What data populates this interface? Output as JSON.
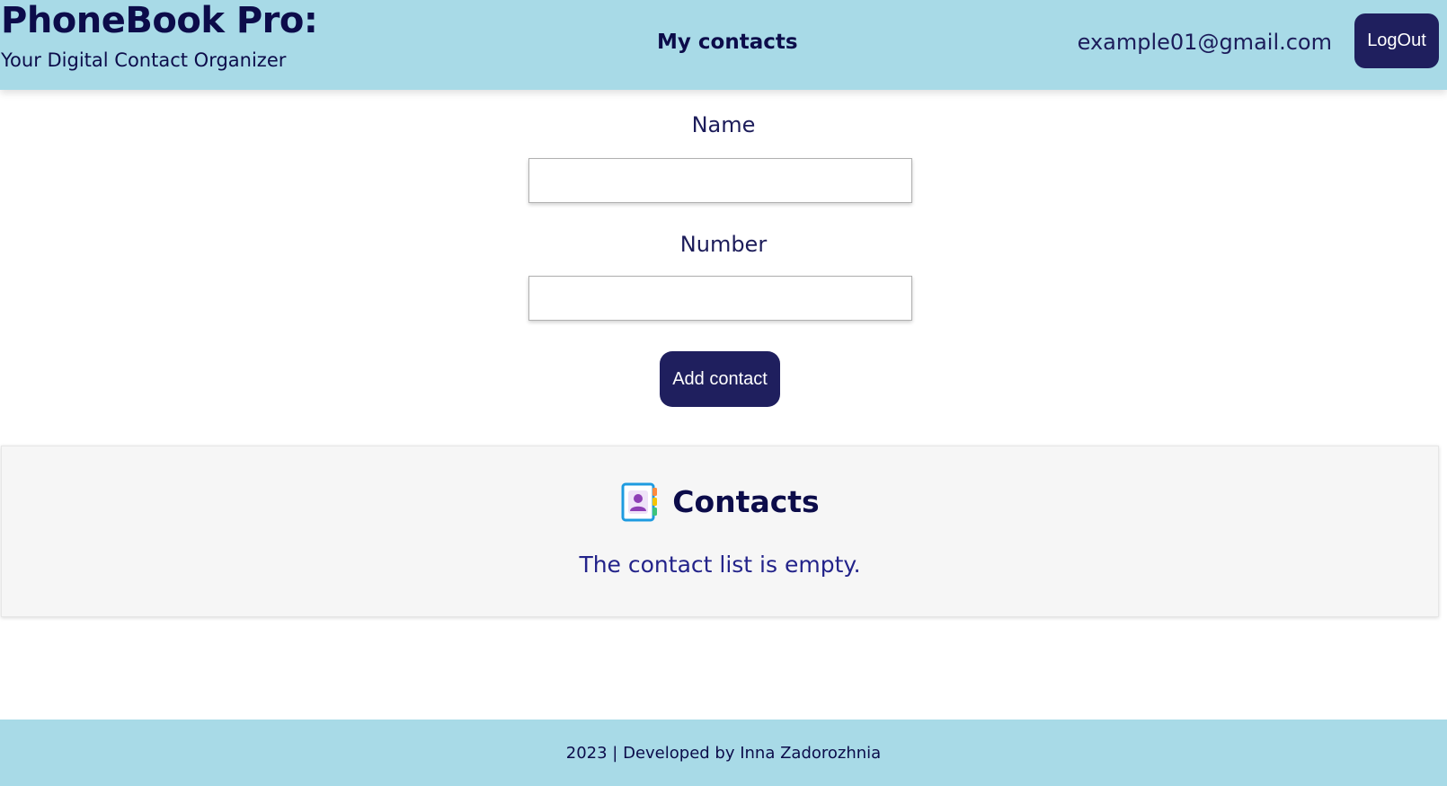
{
  "header": {
    "title": "PhoneBook Pro:",
    "subtitle": "Your Digital Contact Organizer",
    "nav_link": "My contacts",
    "user_email": "example01@gmail.com",
    "logout_label": "LogOut"
  },
  "form": {
    "name_label": "Name",
    "name_value": "",
    "number_label": "Number",
    "number_value": "",
    "submit_label": "Add contact"
  },
  "contacts": {
    "title": "Contacts",
    "icon": "address-book-icon",
    "empty_message": "The contact list is empty."
  },
  "footer": {
    "text": "2023 | Developed by Inna Zadorozhnia"
  },
  "colors": {
    "header_bg": "#a8dae7",
    "primary_button": "#1f1f5e",
    "text_dark": "#0c0c4a",
    "panel_bg": "#f6f6f6"
  }
}
